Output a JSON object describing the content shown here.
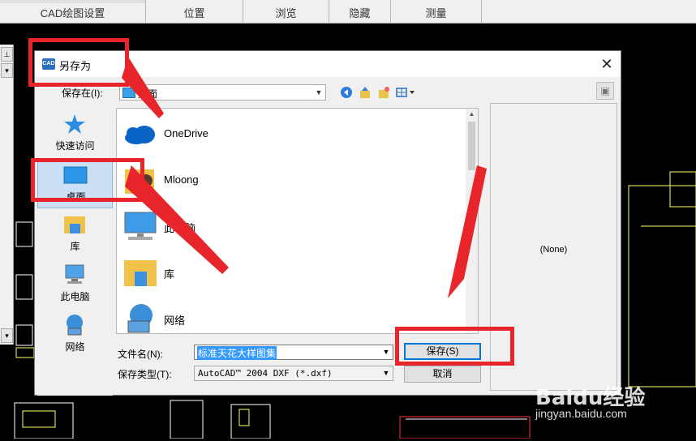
{
  "ribbon": {
    "tabs": [
      "CAD绘图设置",
      "位置",
      "浏览",
      "隐藏",
      "测量"
    ]
  },
  "dialog": {
    "title": "另存为",
    "app_icon": "CAD",
    "close": "✕",
    "save_in_label": "保存在(I):",
    "save_in_value": "桌面",
    "places": [
      "快速访问",
      "桌面",
      "库",
      "此电脑",
      "网络"
    ],
    "files": [
      "OneDrive",
      "Mloong",
      "此电脑",
      "库",
      "网络"
    ],
    "preview_text": "(None)",
    "filename_label": "文件名(N):",
    "filename_value": "标准天花大样图集",
    "filetype_label": "保存类型(T):",
    "filetype_value": "AutoCAD™ 2004 DXF (*.dxf)",
    "save_button": "保存(S)",
    "cancel_button": "取消"
  },
  "watermark": {
    "logo": "Baidu经验",
    "url": "jingyan.baidu.com"
  },
  "colors": {
    "accent": "#0078d7",
    "annotation": "#e8252a"
  }
}
